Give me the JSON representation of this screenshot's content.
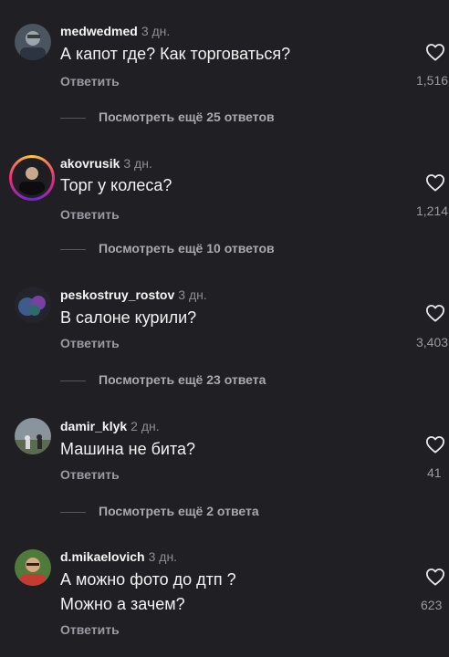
{
  "comments": [
    {
      "username": "medwedmed",
      "time": "3 дн.",
      "text": "А капот где? Как торговаться?",
      "reply": "Ответить",
      "likes": "1,516",
      "more": "Посмотреть ещё 25 ответов"
    },
    {
      "username": "akovrusik",
      "time": "3 дн.",
      "text": "Торг у колеса?",
      "reply": "Ответить",
      "likes": "1,214",
      "more": "Посмотреть ещё 10 ответов"
    },
    {
      "username": "peskostruy_rostov",
      "time": "3 дн.",
      "text": "В салоне курили?",
      "reply": "Ответить",
      "likes": "3,403",
      "more": "Посмотреть ещё 23 ответа"
    },
    {
      "username": "damir_klyk",
      "time": "2 дн.",
      "text": "Машина не бита?",
      "reply": "Ответить",
      "likes": "41",
      "more": "Посмотреть ещё 2 ответа"
    },
    {
      "username": "d.mikaelovich",
      "time": "3 дн.",
      "text": "А можно фото до дтп ?",
      "text2": "Можно а зачем?",
      "reply": "Ответить",
      "likes": "623"
    }
  ],
  "icons": {
    "like": "heart-outline-icon"
  },
  "colors": {
    "background": "#1f1f24",
    "secondary_text": "#9a9aa1"
  }
}
